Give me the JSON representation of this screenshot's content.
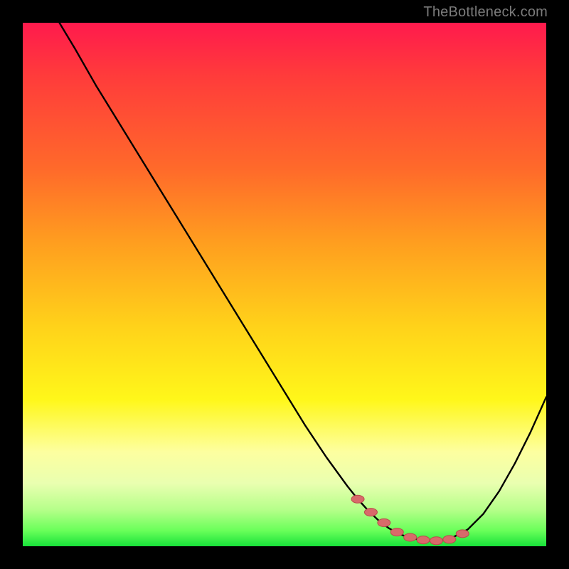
{
  "watermark": "TheBottleneck.com",
  "colors": {
    "bg": "#000000",
    "gradient_top": "#ff1a4d",
    "gradient_bottom": "#18e23a",
    "curve": "#000000",
    "marker_fill": "#d86a6a",
    "marker_stroke": "#b94b4b"
  },
  "chart_data": {
    "type": "line",
    "title": "",
    "xlabel": "",
    "ylabel": "",
    "xlim": [
      0,
      100
    ],
    "ylim": [
      0,
      100
    ],
    "grid": false,
    "legend": false,
    "series": [
      {
        "name": "curve",
        "x": [
          7,
          10,
          14,
          18,
          22,
          26,
          30,
          34,
          38,
          42,
          46,
          50,
          54,
          58,
          62,
          64,
          66,
          68,
          70,
          72,
          74,
          76,
          78,
          80,
          82,
          85,
          88,
          91,
          94,
          97,
          100
        ],
        "y": [
          100,
          95,
          88,
          81.5,
          75,
          68.5,
          62,
          55.5,
          49,
          42.5,
          36,
          29.5,
          23,
          17,
          11.5,
          9,
          6.8,
          4.9,
          3.4,
          2.3,
          1.6,
          1.2,
          1.05,
          1.1,
          1.6,
          3.2,
          6.2,
          10.5,
          15.8,
          21.8,
          28.5
        ]
      }
    ],
    "markers": {
      "comment": "approximate x positions along the valley floor where red dotted markers appear; y taken from the curve",
      "x": [
        64,
        66.5,
        69,
        71.5,
        74,
        76.5,
        79,
        81.5,
        84
      ],
      "y": [
        9,
        6.5,
        4.5,
        2.7,
        1.7,
        1.2,
        1.05,
        1.3,
        2.4
      ]
    }
  }
}
